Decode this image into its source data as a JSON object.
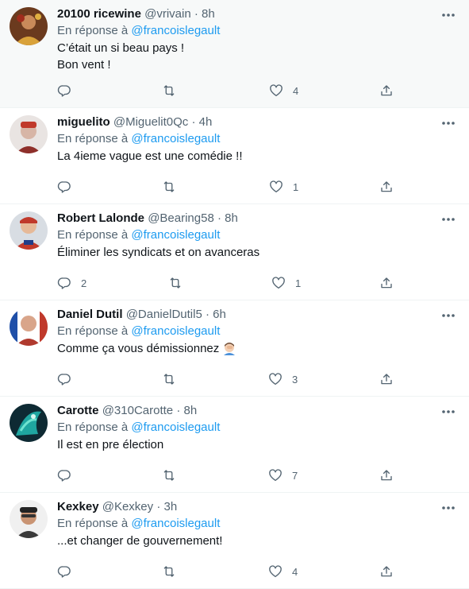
{
  "reply_prefix": "En réponse à",
  "tweets": [
    {
      "name": "20100 ricewine",
      "handle": "@vrivain",
      "dot": "·",
      "time": "8h",
      "mention": "@francoislegault",
      "lines": [
        "C’était un si beau pays !",
        "Bon vent !"
      ],
      "replies": "",
      "retweets": "",
      "likes": "4"
    },
    {
      "name": "miguelito",
      "handle": "@Miguelit0Qc",
      "dot": "·",
      "time": "4h",
      "mention": "@francoislegault",
      "lines": [
        "La 4ieme vague est une comédie !!"
      ],
      "replies": "",
      "retweets": "",
      "likes": "1"
    },
    {
      "name": "Robert Lalonde",
      "handle": "@Bearing58",
      "dot": "·",
      "time": "8h",
      "mention": "@francoislegault",
      "lines": [
        "Éliminer les syndicats et on avanceras"
      ],
      "replies": "2",
      "retweets": "",
      "likes": "1"
    },
    {
      "name": "Daniel Dutil",
      "handle": "@DanielDutil5",
      "dot": "·",
      "time": "6h",
      "mention": "@francoislegault",
      "lines": [
        "Comme ça vous démissionnez"
      ],
      "emoji": "man-facepalming-emoji",
      "replies": "",
      "retweets": "",
      "likes": "3"
    },
    {
      "name": "Carotte",
      "handle": "@310Carotte",
      "dot": "·",
      "time": "8h",
      "mention": "@francoislegault",
      "lines": [
        "Il est en pre élection"
      ],
      "replies": "",
      "retweets": "",
      "likes": "7"
    },
    {
      "name": "Kexkey",
      "handle": "@Kexkey",
      "dot": "·",
      "time": "3h",
      "mention": "@francoislegault",
      "lines": [
        "...et changer de gouvernement!"
      ],
      "replies": "",
      "retweets": "",
      "likes": "4"
    }
  ],
  "icons": {
    "reply": "reply-icon",
    "retweet": "retweet-icon",
    "like": "heart-icon",
    "share": "share-icon",
    "more": "more-options-icon"
  },
  "colors": {
    "link": "#1d9bf0",
    "secondary_text": "#536471",
    "primary_text": "#0f1419",
    "highlight_bg": "#f7f9f9",
    "divider": "#eff3f4"
  }
}
